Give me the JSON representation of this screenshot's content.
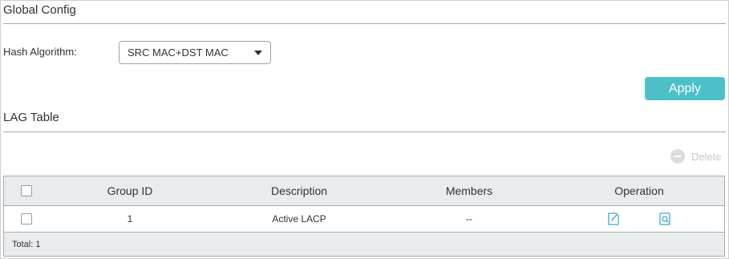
{
  "global_config": {
    "title": "Global Config",
    "hash_label": "Hash Algorithm:",
    "hash_value": "SRC MAC+DST MAC",
    "apply_label": "Apply"
  },
  "lag_table": {
    "title": "LAG Table",
    "delete_label": "Delete",
    "columns": {
      "group_id": "Group ID",
      "description": "Description",
      "members": "Members",
      "operation": "Operation"
    },
    "rows": [
      {
        "group_id": "1",
        "description": "Active LACP",
        "members": "--"
      }
    ],
    "footer": "Total: 1"
  },
  "colors": {
    "accent": "#4bc0c9",
    "header_bg": "#e8ecef",
    "edit_icon": "#3fa9d6"
  },
  "icons": {
    "edit": "edit-icon",
    "detail": "detail-icon",
    "delete": "minus-circle-icon",
    "dropdown": "chevron-down-icon"
  }
}
